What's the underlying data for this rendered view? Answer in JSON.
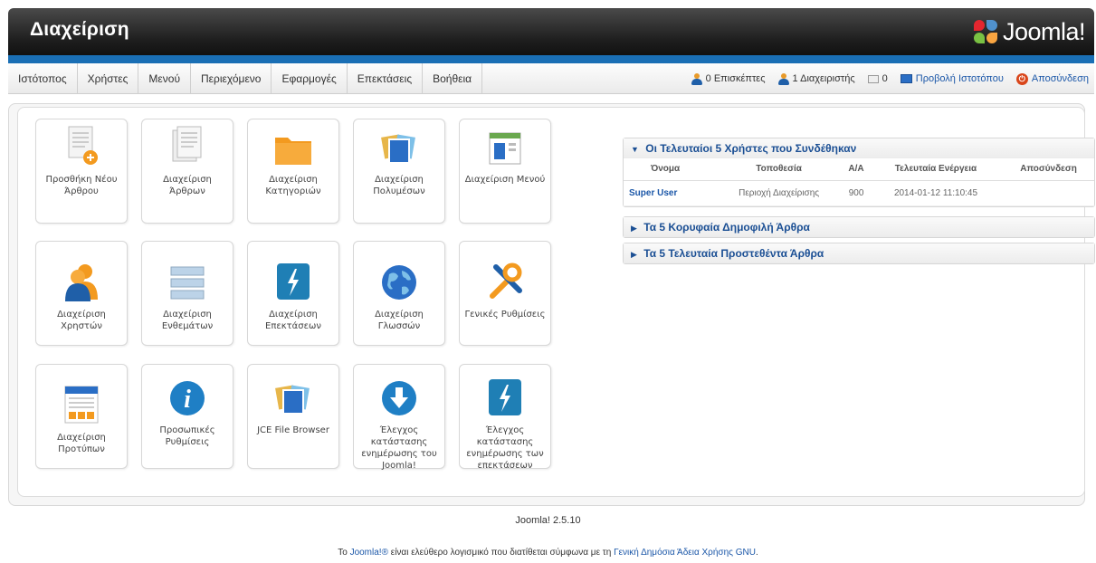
{
  "header": {
    "title": "Διαχείριση",
    "logo_text": "Joomla!"
  },
  "menu": [
    {
      "label": "Ιστότοπος"
    },
    {
      "label": "Χρήστες"
    },
    {
      "label": "Μενού"
    },
    {
      "label": "Περιεχόμενο"
    },
    {
      "label": "Εφαρμογές"
    },
    {
      "label": "Επεκτάσεις"
    },
    {
      "label": "Βοήθεια"
    }
  ],
  "status": {
    "visitors": "0 Επισκέπτες",
    "admins": "1 Διαχειριστής",
    "messages": "0",
    "view_site": "Προβολή Ιστοτόπου",
    "logout": "Αποσύνδεση"
  },
  "quickicons": [
    {
      "label": "Προσθήκη Νέου Άρθρου",
      "icon": "add-article-icon"
    },
    {
      "label": "Διαχείριση Άρθρων",
      "icon": "articles-icon"
    },
    {
      "label": "Διαχείριση Κατηγοριών",
      "icon": "folder-icon"
    },
    {
      "label": "Διαχείριση Πολυμέσων",
      "icon": "media-icon"
    },
    {
      "label": "Διαχείριση Μενού",
      "icon": "menu-icon"
    },
    {
      "label": "Διαχείριση Χρηστών",
      "icon": "users-icon"
    },
    {
      "label": "Διαχείριση Ενθεμάτων",
      "icon": "modules-icon"
    },
    {
      "label": "Διαχείριση Επεκτάσεων",
      "icon": "extensions-icon"
    },
    {
      "label": "Διαχείριση Γλωσσών",
      "icon": "globe-icon"
    },
    {
      "label": "Γενικές Ρυθμίσεις",
      "icon": "tools-icon"
    },
    {
      "label": "Διαχείριση Προτύπων",
      "icon": "templates-icon"
    },
    {
      "label": "Προσωπικές Ρυθμίσεις",
      "icon": "info-icon"
    },
    {
      "label": "JCE File Browser",
      "icon": "file-browser-icon"
    },
    {
      "label": "Έλεγχος κατάστασης ενημέρωσης του Joomla!",
      "icon": "download-icon"
    },
    {
      "label": "Έλεγχος κατάστασης ενημέρωσης των επεκτάσεων",
      "icon": "lightning-icon"
    }
  ],
  "modules": {
    "logged_users": {
      "title": "Οι Τελευταίοι 5 Χρήστες που Συνδέθηκαν",
      "headers": [
        "Όνομα",
        "Τοποθεσία",
        "Α/Α",
        "Τελευταία Ενέργεια",
        "Αποσύνδεση"
      ],
      "rows": [
        {
          "name": "Super User",
          "location": "Περιοχή Διαχείρισης",
          "id": "900",
          "last": "2014-01-12 11:10:45",
          "logout": ""
        }
      ]
    },
    "popular": {
      "title": "Τα 5 Κορυφαία Δημοφιλή Άρθρα"
    },
    "latest": {
      "title": "Τα 5 Τελευταία Προστεθέντα Άρθρα"
    }
  },
  "footer": {
    "version": "Joomla! 2.5.10",
    "license_pre": "Το ",
    "license_link1": "Joomla!®",
    "license_mid": " είναι ελεύθερο λογισμικό που διατίθεται σύμφωνα με τη ",
    "license_link2": "Γενική Δημόσια Άδεια Χρήσης GNU",
    "license_post": "."
  },
  "colors": {
    "accent_blue": "#1a6fb5",
    "header_dark": "#1d1d1d",
    "link": "#1b57a8",
    "orange": "#f39a1f"
  }
}
